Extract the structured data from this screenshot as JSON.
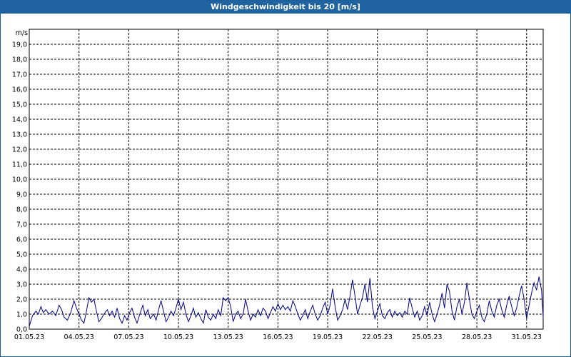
{
  "window": {
    "title": "Windgeschwindigkeit bis 20 [m/s]"
  },
  "chart_data": {
    "type": "line",
    "title": "Windgeschwindigkeit bis 20 [m/s]",
    "ylabel": "m/s",
    "xlabel": "",
    "ylim": [
      0,
      20
    ],
    "xlim": [
      0,
      31
    ],
    "grid": true,
    "y_ticks": [
      "0,0",
      "1,0",
      "2,0",
      "3,0",
      "4,0",
      "5,0",
      "6,0",
      "7,0",
      "8,0",
      "9,0",
      "10,0",
      "11,0",
      "12,0",
      "13,0",
      "14,0",
      "15,0",
      "16,0",
      "17,0",
      "18,0",
      "19,0"
    ],
    "x_ticks": [
      {
        "label": "01.05.23",
        "day": 0
      },
      {
        "label": "04.05.23",
        "day": 3
      },
      {
        "label": "07.05.23",
        "day": 6
      },
      {
        "label": "10.05.23",
        "day": 9
      },
      {
        "label": "13.05.23",
        "day": 12
      },
      {
        "label": "16.05.23",
        "day": 15
      },
      {
        "label": "19.05.23",
        "day": 18
      },
      {
        "label": "22.05.23",
        "day": 21
      },
      {
        "label": "25.05.23",
        "day": 24
      },
      {
        "label": "28.05.23",
        "day": 27
      },
      {
        "label": "31.05.23",
        "day": 30
      }
    ],
    "series": [
      {
        "color": "#00008b",
        "points": [
          [
            0.0,
            0.2
          ],
          [
            0.2,
            0.9
          ],
          [
            0.4,
            1.2
          ],
          [
            0.55,
            1.0
          ],
          [
            0.7,
            1.5
          ],
          [
            0.85,
            1.1
          ],
          [
            1.0,
            1.3
          ],
          [
            1.2,
            1.0
          ],
          [
            1.4,
            1.2
          ],
          [
            1.6,
            0.9
          ],
          [
            1.8,
            1.6
          ],
          [
            1.95,
            1.3
          ],
          [
            2.1,
            0.8
          ],
          [
            2.3,
            0.6
          ],
          [
            2.5,
            1.1
          ],
          [
            2.7,
            1.9
          ],
          [
            2.85,
            1.4
          ],
          [
            3.0,
            1.0
          ],
          [
            3.15,
            0.6
          ],
          [
            3.3,
            0.4
          ],
          [
            3.45,
            1.2
          ],
          [
            3.6,
            2.1
          ],
          [
            3.75,
            1.8
          ],
          [
            3.9,
            2.0
          ],
          [
            4.05,
            1.2
          ],
          [
            4.2,
            0.5
          ],
          [
            4.35,
            0.7
          ],
          [
            4.5,
            1.0
          ],
          [
            4.7,
            1.3
          ],
          [
            4.85,
            0.9
          ],
          [
            5.0,
            1.2
          ],
          [
            5.15,
            0.8
          ],
          [
            5.3,
            1.4
          ],
          [
            5.45,
            0.7
          ],
          [
            5.6,
            0.4
          ],
          [
            5.75,
            0.9
          ],
          [
            5.9,
            0.6
          ],
          [
            6.05,
            1.1
          ],
          [
            6.2,
            1.4
          ],
          [
            6.35,
            0.8
          ],
          [
            6.5,
            0.4
          ],
          [
            6.7,
            1.1
          ],
          [
            6.85,
            1.6
          ],
          [
            7.0,
            0.9
          ],
          [
            7.15,
            1.3
          ],
          [
            7.3,
            0.7
          ],
          [
            7.5,
            1.0
          ],
          [
            7.65,
            0.6
          ],
          [
            7.8,
            1.3
          ],
          [
            7.95,
            1.9
          ],
          [
            8.1,
            1.2
          ],
          [
            8.25,
            0.5
          ],
          [
            8.4,
            0.8
          ],
          [
            8.55,
            1.2
          ],
          [
            8.7,
            0.9
          ],
          [
            8.85,
            1.4
          ],
          [
            9.0,
            2.0
          ],
          [
            9.15,
            1.3
          ],
          [
            9.3,
            1.8
          ],
          [
            9.45,
            1.0
          ],
          [
            9.6,
            0.5
          ],
          [
            9.75,
            0.9
          ],
          [
            9.9,
            1.4
          ],
          [
            10.05,
            0.8
          ],
          [
            10.2,
            1.1
          ],
          [
            10.35,
            0.7
          ],
          [
            10.5,
            0.4
          ],
          [
            10.65,
            1.3
          ],
          [
            10.8,
            0.8
          ],
          [
            10.95,
            0.6
          ],
          [
            11.1,
            1.0
          ],
          [
            11.25,
            0.7
          ],
          [
            11.4,
            1.3
          ],
          [
            11.55,
            0.9
          ],
          [
            11.7,
            2.1
          ],
          [
            11.85,
            1.9
          ],
          [
            12.0,
            2.1
          ],
          [
            12.15,
            1.5
          ],
          [
            12.3,
            0.5
          ],
          [
            12.45,
            1.0
          ],
          [
            12.6,
            1.2
          ],
          [
            12.75,
            0.7
          ],
          [
            12.9,
            1.0
          ],
          [
            13.05,
            2.0
          ],
          [
            13.2,
            1.2
          ],
          [
            13.35,
            0.6
          ],
          [
            13.5,
            1.0
          ],
          [
            13.65,
            0.8
          ],
          [
            13.8,
            1.3
          ],
          [
            13.95,
            0.9
          ],
          [
            14.1,
            1.4
          ],
          [
            14.25,
            1.2
          ],
          [
            14.4,
            0.7
          ],
          [
            14.55,
            1.1
          ],
          [
            14.7,
            1.5
          ],
          [
            14.85,
            1.2
          ],
          [
            15.0,
            1.7
          ],
          [
            15.15,
            1.3
          ],
          [
            15.3,
            1.6
          ],
          [
            15.45,
            1.3
          ],
          [
            15.6,
            1.5
          ],
          [
            15.75,
            1.2
          ],
          [
            15.9,
            1.9
          ],
          [
            16.05,
            1.5
          ],
          [
            16.2,
            1.0
          ],
          [
            16.35,
            0.6
          ],
          [
            16.5,
            0.9
          ],
          [
            16.65,
            1.3
          ],
          [
            16.8,
            0.7
          ],
          [
            16.95,
            1.2
          ],
          [
            17.1,
            1.6
          ],
          [
            17.25,
            1.0
          ],
          [
            17.4,
            0.6
          ],
          [
            17.55,
            0.9
          ],
          [
            17.7,
            1.4
          ],
          [
            17.85,
            1.8
          ],
          [
            18.0,
            1.0
          ],
          [
            18.15,
            1.6
          ],
          [
            18.3,
            2.7
          ],
          [
            18.45,
            1.5
          ],
          [
            18.6,
            0.6
          ],
          [
            18.75,
            0.9
          ],
          [
            18.9,
            1.3
          ],
          [
            19.05,
            2.0
          ],
          [
            19.2,
            1.3
          ],
          [
            19.35,
            2.2
          ],
          [
            19.5,
            3.3
          ],
          [
            19.65,
            2.2
          ],
          [
            19.8,
            1.0
          ],
          [
            19.95,
            1.6
          ],
          [
            20.1,
            2.1
          ],
          [
            20.25,
            3.0
          ],
          [
            20.4,
            1.8
          ],
          [
            20.55,
            3.4
          ],
          [
            20.7,
            1.5
          ],
          [
            20.85,
            0.7
          ],
          [
            21.0,
            1.2
          ],
          [
            21.15,
            1.7
          ],
          [
            21.3,
            0.9
          ],
          [
            21.45,
            0.7
          ],
          [
            21.6,
            1.1
          ],
          [
            21.75,
            1.3
          ],
          [
            21.9,
            0.8
          ],
          [
            22.05,
            1.2
          ],
          [
            22.2,
            0.9
          ],
          [
            22.35,
            1.1
          ],
          [
            22.5,
            0.8
          ],
          [
            22.65,
            1.2
          ],
          [
            22.8,
            1.0
          ],
          [
            22.95,
            2.1
          ],
          [
            23.1,
            1.4
          ],
          [
            23.25,
            0.8
          ],
          [
            23.4,
            1.2
          ],
          [
            23.55,
            0.6
          ],
          [
            23.7,
            0.9
          ],
          [
            23.85,
            1.5
          ],
          [
            24.0,
            0.9
          ],
          [
            24.15,
            1.8
          ],
          [
            24.3,
            1.0
          ],
          [
            24.45,
            0.5
          ],
          [
            24.6,
            1.0
          ],
          [
            24.75,
            1.6
          ],
          [
            24.9,
            2.4
          ],
          [
            25.05,
            1.4
          ],
          [
            25.2,
            3.0
          ],
          [
            25.35,
            2.5
          ],
          [
            25.5,
            1.2
          ],
          [
            25.65,
            0.6
          ],
          [
            25.8,
            1.5
          ],
          [
            25.95,
            2.0
          ],
          [
            26.1,
            1.0
          ],
          [
            26.25,
            1.8
          ],
          [
            26.4,
            3.1
          ],
          [
            26.55,
            2.0
          ],
          [
            26.7,
            1.0
          ],
          [
            26.85,
            0.7
          ],
          [
            27.0,
            1.2
          ],
          [
            27.15,
            1.6
          ],
          [
            27.3,
            0.8
          ],
          [
            27.45,
            0.5
          ],
          [
            27.6,
            1.0
          ],
          [
            27.75,
            1.9
          ],
          [
            27.9,
            1.2
          ],
          [
            28.05,
            0.8
          ],
          [
            28.2,
            1.6
          ],
          [
            28.35,
            2.0
          ],
          [
            28.5,
            1.3
          ],
          [
            28.65,
            0.8
          ],
          [
            28.8,
            1.6
          ],
          [
            28.95,
            2.2
          ],
          [
            29.1,
            1.5
          ],
          [
            29.25,
            0.9
          ],
          [
            29.4,
            1.4
          ],
          [
            29.55,
            2.2
          ],
          [
            29.7,
            2.9
          ],
          [
            29.85,
            2.0
          ],
          [
            30.0,
            0.7
          ],
          [
            30.15,
            1.6
          ],
          [
            30.3,
            2.4
          ],
          [
            30.45,
            3.1
          ],
          [
            30.6,
            2.6
          ],
          [
            30.75,
            3.5
          ],
          [
            30.9,
            2.6
          ],
          [
            31.0,
            0.8
          ]
        ]
      }
    ]
  }
}
